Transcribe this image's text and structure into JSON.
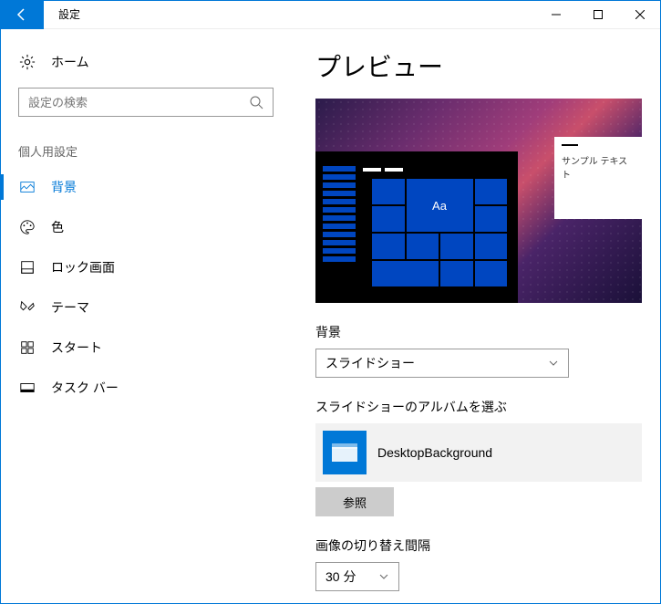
{
  "titlebar": {
    "title": "設定"
  },
  "sidebar": {
    "home_label": "ホーム",
    "search_placeholder": "設定の検索",
    "section_label": "個人用設定",
    "items": [
      {
        "label": "背景"
      },
      {
        "label": "色"
      },
      {
        "label": "ロック画面"
      },
      {
        "label": "テーマ"
      },
      {
        "label": "スタート"
      },
      {
        "label": "タスク バー"
      }
    ]
  },
  "content": {
    "page_title": "プレビュー",
    "sample_text": "サンプル テキスト",
    "tile_text": "Aa",
    "background_label": "背景",
    "background_value": "スライドショー",
    "album_label": "スライドショーのアルバムを選ぶ",
    "album_value": "DesktopBackground",
    "browse_label": "参照",
    "interval_label": "画像の切り替え間隔",
    "interval_value": "30 分"
  }
}
